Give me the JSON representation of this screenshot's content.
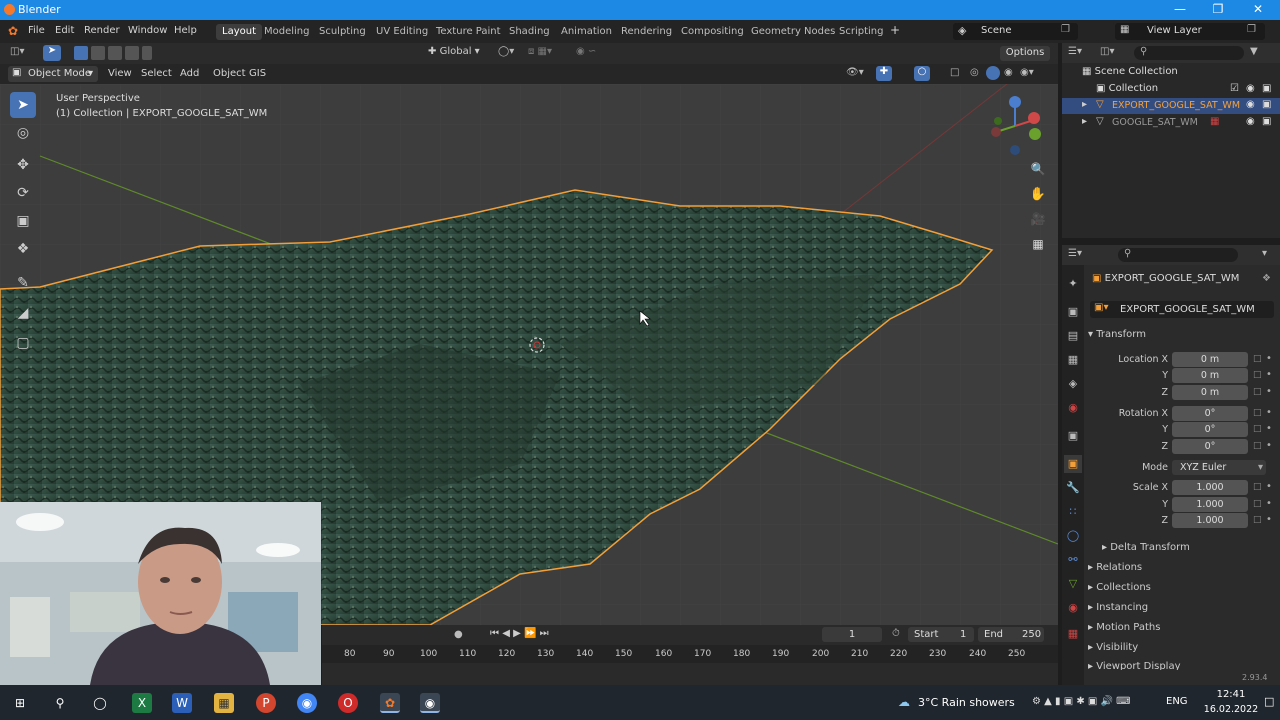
{
  "window": {
    "title": "Blender"
  },
  "menu": {
    "items": [
      "File",
      "Edit",
      "Render",
      "Window",
      "Help"
    ]
  },
  "workspaces": [
    "Layout",
    "Modeling",
    "Sculpting",
    "UV Editing",
    "Texture Paint",
    "Shading",
    "Animation",
    "Rendering",
    "Compositing",
    "Geometry Nodes",
    "Scripting"
  ],
  "active_workspace": "Layout",
  "scene": {
    "name": "Scene"
  },
  "view_layer": {
    "name": "View Layer"
  },
  "toolheader": {
    "orientation": "Global",
    "options_label": "Options"
  },
  "viewport_header": {
    "mode": "Object Mode",
    "menus": [
      "View",
      "Select",
      "Add",
      "Object",
      "GIS"
    ]
  },
  "viewport": {
    "perspective_label": "User Perspective",
    "collection_label": "(1) Collection | EXPORT_GOOGLE_SAT_WM"
  },
  "outliner": {
    "root": "Scene Collection",
    "items": [
      {
        "name": "Collection"
      },
      {
        "name": "EXPORT_GOOGLE_SAT_WM"
      },
      {
        "name": "GOOGLE_SAT_WM"
      }
    ]
  },
  "properties": {
    "object_name": "EXPORT_GOOGLE_SAT_WM",
    "data_name": "EXPORT_GOOGLE_SAT_WM",
    "transform_label": "Transform",
    "location": {
      "label": "Location X",
      "x": "0 m",
      "y": "0 m",
      "z": "0 m"
    },
    "rotation": {
      "label": "Rotation X",
      "x": "0°",
      "y": "0°",
      "z": "0°"
    },
    "mode": {
      "label": "Mode",
      "value": "XYZ Euler"
    },
    "scale": {
      "label": "Scale X",
      "x": "1.000",
      "y": "1.000",
      "z": "1.000"
    },
    "axis_y": "Y",
    "axis_z": "Z",
    "sections": [
      "Delta Transform",
      "Relations",
      "Collections",
      "Instancing",
      "Motion Paths",
      "Visibility",
      "Viewport Display"
    ]
  },
  "timeline": {
    "current_frame": "1",
    "start_label": "Start",
    "start": "1",
    "end_label": "End",
    "end": "250",
    "ticks": [
      "80",
      "90",
      "100",
      "110",
      "120",
      "130",
      "140",
      "150",
      "160",
      "170",
      "180",
      "190",
      "200",
      "210",
      "220",
      "230",
      "240",
      "250"
    ]
  },
  "status": {
    "version": "2.93.4"
  },
  "taskbar": {
    "weather": "3°C  Rain showers",
    "lang": "ENG",
    "time": "12:41",
    "date": "16.02.2022"
  }
}
